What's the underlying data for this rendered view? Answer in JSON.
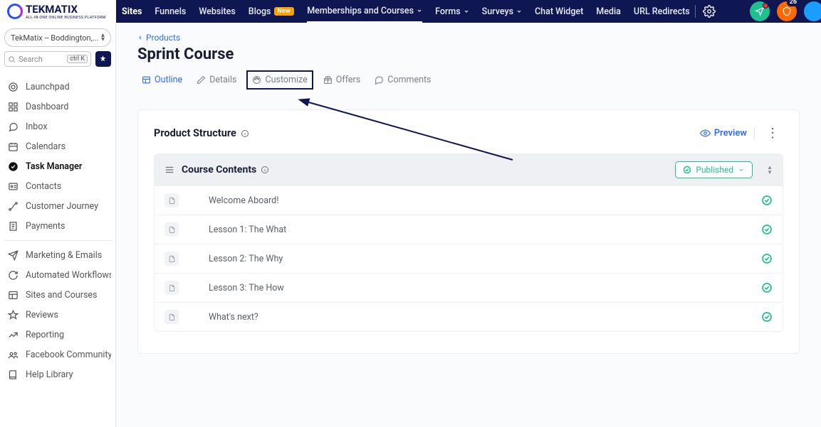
{
  "topnav": {
    "logo": "TEKMATIX",
    "tagline": "ALL-IN-ONE ONLINE BUSINESS PLATFORM",
    "items": [
      {
        "label": "Sites",
        "active": true
      },
      {
        "label": "Funnels"
      },
      {
        "label": "Websites"
      },
      {
        "label": "Blogs",
        "badge": "New"
      },
      {
        "label": "Memberships and Courses",
        "dropdown": true,
        "current": true
      },
      {
        "label": "Forms",
        "dropdown": true
      },
      {
        "label": "Surveys",
        "dropdown": true
      },
      {
        "label": "Chat Widget"
      },
      {
        "label": "Media"
      },
      {
        "label": "URL Redirects"
      }
    ],
    "notif_count": "26"
  },
  "sidebar": {
    "account": "TekMatix -- Boddington,...",
    "search_placeholder": "Search",
    "search_kbd": "ctrl K",
    "groups": [
      [
        {
          "label": "Launchpad",
          "icon": "target"
        },
        {
          "label": "Dashboard",
          "icon": "grid"
        },
        {
          "label": "Inbox",
          "icon": "chat"
        },
        {
          "label": "Calendars",
          "icon": "calendar"
        },
        {
          "label": "Task Manager",
          "icon": "check",
          "active": true
        },
        {
          "label": "Contacts",
          "icon": "id"
        },
        {
          "label": "Customer Journey",
          "icon": "path"
        },
        {
          "label": "Payments",
          "icon": "receipt"
        }
      ],
      [
        {
          "label": "Marketing & Emails",
          "icon": "send"
        },
        {
          "label": "Automated Workflows",
          "icon": "cycle"
        },
        {
          "label": "Sites and Courses",
          "icon": "layout"
        },
        {
          "label": "Reviews",
          "icon": "star"
        },
        {
          "label": "Reporting",
          "icon": "trend"
        },
        {
          "label": "Facebook Community G...",
          "icon": "people"
        },
        {
          "label": "Help Library",
          "icon": "book"
        }
      ]
    ]
  },
  "page": {
    "crumb": "Products",
    "title": "Sprint Course",
    "tabs": [
      {
        "key": "outline",
        "label": "Outline",
        "icon": "layout",
        "active": true
      },
      {
        "key": "details",
        "label": "Details",
        "icon": "pencil"
      },
      {
        "key": "customize",
        "label": "Customize",
        "icon": "palette",
        "boxed": true
      },
      {
        "key": "offers",
        "label": "Offers",
        "icon": "gift"
      },
      {
        "key": "comments",
        "label": "Comments",
        "icon": "comment"
      }
    ],
    "structure_title": "Product Structure",
    "preview": "Preview",
    "contents_title": "Course Contents",
    "publish_label": "Published",
    "lessons": [
      "Welcome Aboard!",
      "Lesson 1: The What",
      "Lesson 2: The Why",
      "Lesson 3: The How",
      "What's next?"
    ]
  }
}
